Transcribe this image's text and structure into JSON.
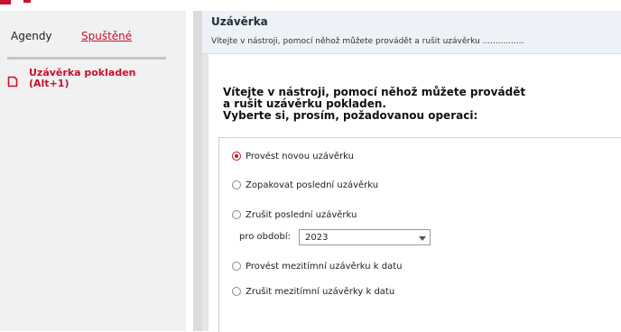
{
  "sidebar": {
    "tabs": [
      {
        "label": "Agendy"
      },
      {
        "label": "Spuštěné"
      }
    ],
    "running_item": {
      "label": "Uzávěrka pokladen (Alt+1)",
      "icon": "document-icon"
    }
  },
  "header": {
    "title": "Uzávěrka",
    "subtitle": "Vítejte v nástroji, pomocí něhož můžete provádět a rušit uzávěrku ................"
  },
  "main": {
    "intro_line1": "Vítejte v nástroji, pomocí něhož můžete provádět",
    "intro_line2": "a rušit uzávěrku pokladen.",
    "intro_line3": "Vyberte si, prosím, požadovanou operaci:",
    "options": [
      {
        "label": "Provést novou uzávěrku",
        "selected": true
      },
      {
        "label": "Zopakovat poslední uzávěrku",
        "selected": false
      },
      {
        "label": "Zrušit poslední uzávěrku",
        "selected": false
      },
      {
        "label": "Provést mezitímní uzávěrku k datu",
        "selected": false
      },
      {
        "label": "Zrušit mezitímní uzávěrky k datu",
        "selected": false
      }
    ],
    "period": {
      "label": "pro období:",
      "value": "2023"
    }
  },
  "colors": {
    "accent": "#c8102e",
    "header_bg": "#eef2f6",
    "sidebar_bg": "#f1f1f1"
  }
}
